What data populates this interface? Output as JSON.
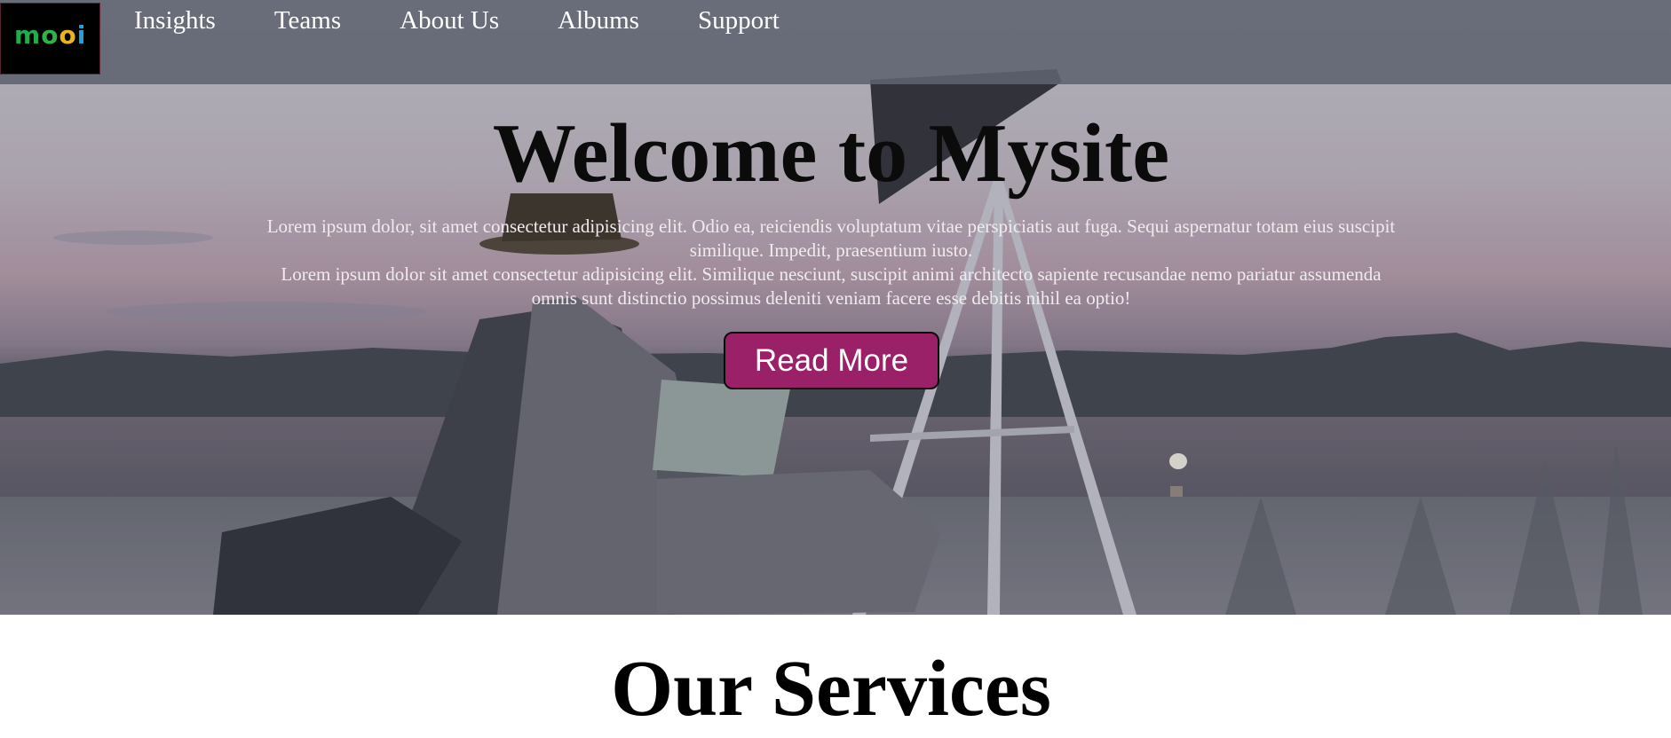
{
  "logo": {
    "letters": [
      "m",
      "o",
      "o",
      "i"
    ],
    "colors": [
      "#1fae4b",
      "#2fb24a",
      "#e9b41d",
      "#23a0e0"
    ]
  },
  "nav": {
    "items": [
      {
        "label": "Insights"
      },
      {
        "label": "Teams"
      },
      {
        "label": "About Us"
      },
      {
        "label": "Albums"
      },
      {
        "label": "Support"
      }
    ]
  },
  "hero": {
    "title": "Welcome to Mysite",
    "paragraph1": "Lorem ipsum dolor, sit amet consectetur adipisicing elit. Odio ea, reiciendis voluptatum vitae perspiciatis aut fuga. Sequi aspernatur totam eius suscipit similique. Impedit, praesentium iusto.",
    "paragraph2": "Lorem ipsum dolor sit amet consectetur adipisicing elit. Similique nesciunt, suscipit animi architecto sapiente recusandae nemo pariatur assumenda omnis sunt distinctio possimus deleniti veniam facere esse debitis nihil ea optio!",
    "button_label": "Read More"
  },
  "services": {
    "title": "Our Services"
  },
  "colors": {
    "navbar": "#5f6370",
    "accent_button": "#9a2168"
  }
}
